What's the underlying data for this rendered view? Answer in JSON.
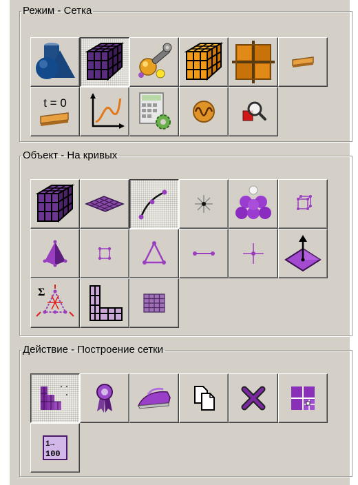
{
  "groups": {
    "mode": {
      "title": "Режим - Сетка",
      "buttons": [
        {
          "icon": "geometry-shapes-icon",
          "pressed": false
        },
        {
          "icon": "purple-mesh-cube-icon",
          "pressed": true
        },
        {
          "icon": "tools-wrench-icon",
          "pressed": false
        },
        {
          "icon": "orange-mesh-cube-icon",
          "pressed": false
        },
        {
          "icon": "orange-grid-icon",
          "pressed": false
        },
        {
          "icon": "strip-icon",
          "pressed": false
        },
        {
          "icon": "time-zero-icon",
          "label": "t = 0",
          "pressed": false
        },
        {
          "icon": "graph-curve-icon",
          "pressed": false
        },
        {
          "icon": "calculator-settings-icon",
          "pressed": false
        },
        {
          "icon": "waveform-icon",
          "pressed": false
        },
        {
          "icon": "magnifier-icon",
          "pressed": false
        }
      ]
    },
    "object": {
      "title": "Объект - На кривых",
      "buttons": [
        {
          "icon": "purple-cube-icon",
          "pressed": false
        },
        {
          "icon": "surface-mesh-icon",
          "pressed": false
        },
        {
          "icon": "curve-icon",
          "pressed": true
        },
        {
          "icon": "star-node-icon",
          "pressed": false
        },
        {
          "icon": "parts-cluster-icon",
          "pressed": false
        },
        {
          "icon": "wireframe-cube-icon",
          "pressed": false
        },
        {
          "icon": "pyramid-icon",
          "pressed": false
        },
        {
          "icon": "square-nodes-icon",
          "pressed": false
        },
        {
          "icon": "triangle-nodes-icon",
          "pressed": false
        },
        {
          "icon": "line-segment-icon",
          "pressed": false
        },
        {
          "icon": "cross-point-icon",
          "pressed": false
        },
        {
          "icon": "plane-normal-icon",
          "pressed": false
        },
        {
          "icon": "sum-constraints-icon",
          "label": "Σ",
          "pressed": false
        },
        {
          "icon": "blocks-corner-icon",
          "pressed": false
        },
        {
          "icon": "grid-table-icon",
          "pressed": false
        }
      ]
    },
    "action": {
      "title": "Действие - Построение сетки",
      "buttons": [
        {
          "icon": "stepped-mesh-icon",
          "pressed": true
        },
        {
          "icon": "award-ribbon-icon",
          "pressed": false
        },
        {
          "icon": "iron-smooth-icon",
          "pressed": false
        },
        {
          "icon": "copy-pages-icon",
          "pressed": false
        },
        {
          "icon": "delete-x-icon",
          "pressed": false
        },
        {
          "icon": "split-blocks-icon",
          "pressed": false
        },
        {
          "icon": "numbering-icon",
          "label_top": "1→",
          "label_bottom": "100",
          "pressed": false
        }
      ]
    }
  }
}
